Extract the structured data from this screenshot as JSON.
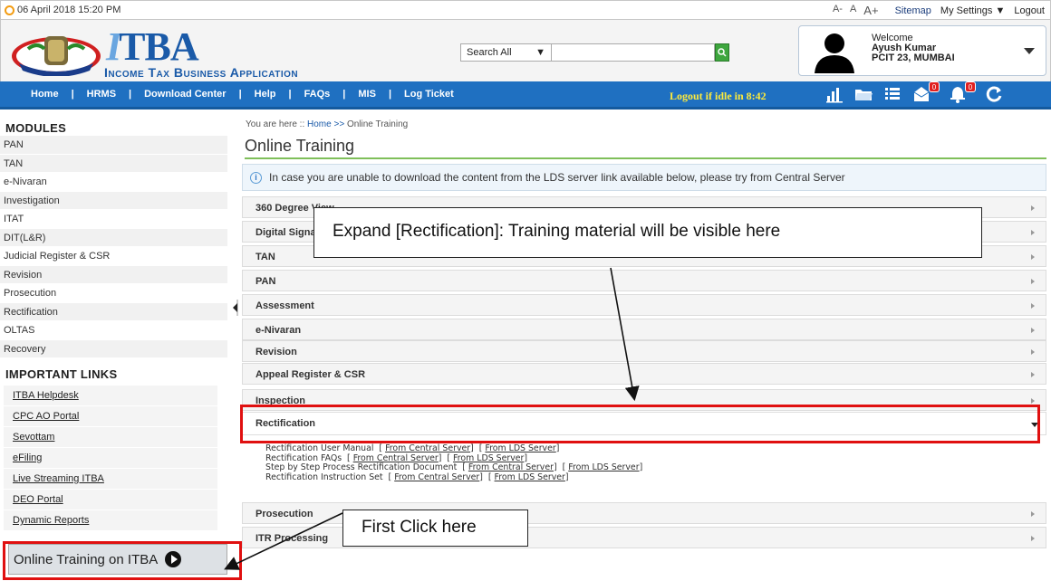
{
  "topbar": {
    "datetime": "06 April 2018 15:20 PM",
    "font_small": "A-",
    "font_normal": "A",
    "font_large": "A+",
    "sitemap": "Sitemap",
    "settings": "My Settings ▼",
    "logout": "Logout"
  },
  "header": {
    "logo_letter": "I",
    "logo_text": "TBA",
    "logo_subtitle": "Income Tax Business Application",
    "search_scope": "Search All",
    "search_input": "",
    "user": {
      "welcome": "Welcome",
      "name": "Ayush Kumar",
      "office": "PCIT 23, MUMBAI"
    }
  },
  "nav": {
    "items": [
      "Home",
      "HRMS",
      "Download Center",
      "Help",
      "FAQs",
      "MIS",
      "Log Ticket"
    ],
    "idle_text": "Logout if idle in  8:42",
    "badge_mail": "0",
    "badge_bell": "0"
  },
  "sidebar": {
    "modules_title": "MODULES",
    "modules": [
      "PAN",
      "TAN",
      "e-Nivaran",
      "Investigation",
      "ITAT",
      "DIT(L&R)",
      "Judicial Register & CSR",
      "Revision",
      "Prosecution",
      "Rectification",
      "OLTAS",
      "Recovery"
    ],
    "links_title": "IMPORTANT LINKS",
    "links": [
      "ITBA Helpdesk",
      "CPC AO Portal",
      "Sevottam",
      "eFiling",
      "Live Streaming ITBA",
      "DEO Portal",
      "Dynamic Reports"
    ],
    "online_training": "Online Training on ITBA"
  },
  "main": {
    "breadcrumb_prefix": "You are here :: ",
    "breadcrumb_home": "Home",
    "breadcrumb_sep": " >> ",
    "breadcrumb_current": "Online Training",
    "title": "Online Training",
    "info": "In case you are unable to download the content from the LDS server link available below, please try from Central Server",
    "sections": [
      "360 Degree View",
      "Digital Signature",
      "TAN",
      "PAN",
      "Assessment",
      "e-Nivaran",
      "Revision",
      "Appeal Register & CSR",
      "Inspection",
      "Rectification",
      "Prosecution",
      "ITR Processing"
    ],
    "docs": [
      {
        "name": "Rectification User Manual",
        "central": "From Central Server",
        "lds": "From LDS Server"
      },
      {
        "name": "Rectification FAQs",
        "central": "From Central Server",
        "lds": "From LDS Server"
      },
      {
        "name": "Step by Step Process Rectification Document",
        "central": "From Central Server",
        "lds": "From LDS Server"
      },
      {
        "name": "Rectification Instruction Set",
        "central": "From Central Server",
        "lds": "From LDS Server"
      }
    ]
  },
  "annotations": {
    "callout_top": "Expand [Rectification]: Training material will be visible here",
    "callout_bottom": "First Click here"
  },
  "colors": {
    "nav_blue": "#1f70c1",
    "highlight_red": "#e01010",
    "title_underline": "#7fbf5a"
  }
}
